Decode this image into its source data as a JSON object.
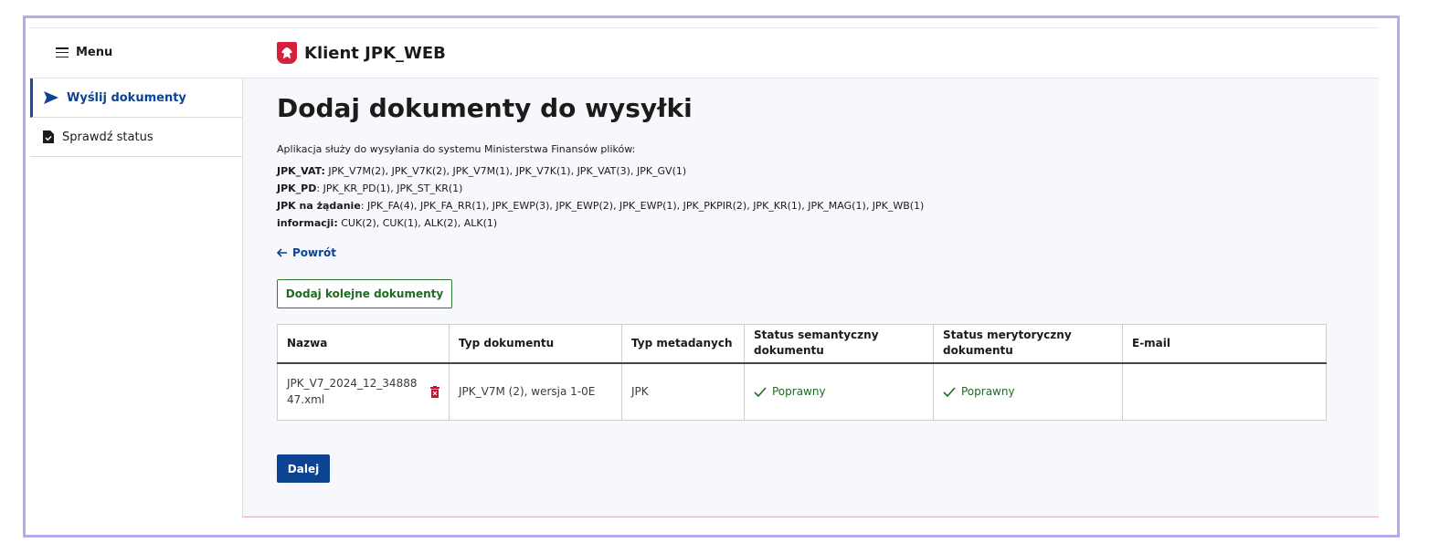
{
  "header": {
    "menu_label": "Menu",
    "brand_title": "Klient JPK_WEB"
  },
  "sidebar": {
    "items": [
      {
        "label": "Wyślij dokumenty",
        "icon": "send-icon",
        "active": true
      },
      {
        "label": "Sprawdź status",
        "icon": "document-check-icon",
        "active": false
      }
    ]
  },
  "main": {
    "title": "Dodaj dokumenty do wysyłki",
    "intro": "Aplikacja służy do wysyłania do systemu Ministerstwa Finansów plików:",
    "groups": [
      {
        "label": "JPK_VAT:",
        "value": " JPK_V7M(2), JPK_V7K(2), JPK_V7M(1), JPK_V7K(1), JPK_VAT(3), JPK_GV(1)"
      },
      {
        "label": "JPK_PD",
        "value": ": JPK_KR_PD(1), JPK_ST_KR(1)"
      },
      {
        "label": "JPK na żądanie",
        "value": ": JPK_FA(4), JPK_FA_RR(1), JPK_EWP(3), JPK_EWP(2), JPK_EWP(1), JPK_PKPIR(2), JPK_KR(1), JPK_MAG(1), JPK_WB(1)"
      },
      {
        "label": "informacji:",
        "value": " CUK(2), CUK(1), ALK(2), ALK(1)"
      }
    ],
    "back_label": "Powrót",
    "add_button": "Dodaj kolejne dokumenty",
    "next_button": "Dalej"
  },
  "table": {
    "headers": [
      "Nazwa",
      "Typ dokumentu",
      "Typ metadanych",
      "Status semantyczny dokumentu",
      "Status merytoryczny dokumentu",
      "E-mail"
    ],
    "rows": [
      {
        "name": "JPK_V7_2024_12_3488847.xml",
        "doc_type": "JPK_V7M (2), wersja 1-0E",
        "meta_type": "JPK",
        "semantic_status": "Poprawny",
        "substantive_status": "Poprawny",
        "email": ""
      }
    ]
  },
  "colors": {
    "accent": "#0c4393",
    "success": "#1f6b24",
    "delete": "#c8102e",
    "frame": "#b8a9ee"
  }
}
